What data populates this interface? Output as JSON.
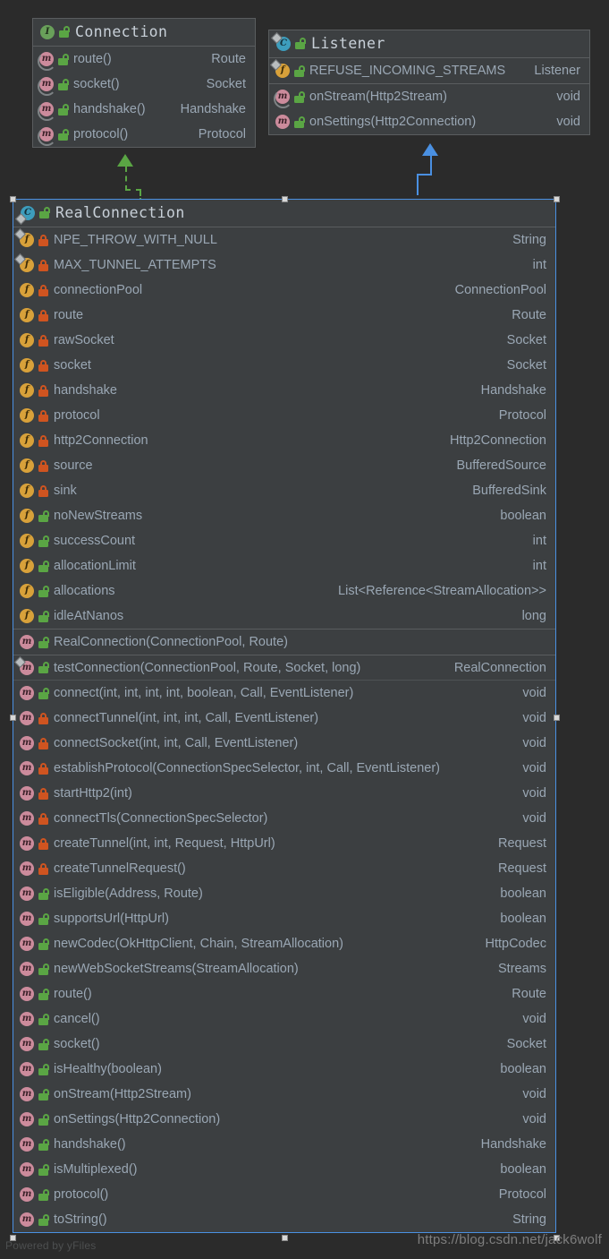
{
  "canvas": {
    "background_color": "#2b2b2b",
    "watermark_tool": "Powered by yFiles",
    "watermark_blog": "https://blog.csdn.net/jack6wolf"
  },
  "boxes": [
    {
      "id": "connection",
      "title": "Connection",
      "stereotype_icon": "interface-icon",
      "visibility": "public",
      "selected": false,
      "sections": [
        {
          "kind": "methods",
          "rows": [
            {
              "icon": "method-icon",
              "abstract": true,
              "static": false,
              "visibility": "public",
              "name": "route()",
              "type": "Route"
            },
            {
              "icon": "method-icon",
              "abstract": true,
              "static": false,
              "visibility": "public",
              "name": "socket()",
              "type": "Socket"
            },
            {
              "icon": "method-icon",
              "abstract": true,
              "static": false,
              "visibility": "public",
              "name": "handshake()",
              "type": "Handshake"
            },
            {
              "icon": "method-icon",
              "abstract": true,
              "static": false,
              "visibility": "public",
              "name": "protocol()",
              "type": "Protocol"
            }
          ]
        }
      ]
    },
    {
      "id": "listener",
      "title": "Listener",
      "stereotype_icon": "class-icon",
      "visibility": "public",
      "selected": false,
      "sections": [
        {
          "kind": "fields",
          "rows": [
            {
              "icon": "field-icon",
              "abstract": false,
              "static": true,
              "visibility": "public",
              "name": "REFUSE_INCOMING_STREAMS",
              "type": "Listener"
            }
          ]
        },
        {
          "kind": "methods",
          "rows": [
            {
              "icon": "method-icon",
              "abstract": true,
              "static": false,
              "visibility": "public",
              "name": "onStream(Http2Stream)",
              "type": "void"
            },
            {
              "icon": "method-icon",
              "abstract": false,
              "static": false,
              "visibility": "public",
              "name": "onSettings(Http2Connection)",
              "type": "void"
            }
          ]
        }
      ]
    },
    {
      "id": "realconnection",
      "title": "RealConnection",
      "stereotype_icon": "class-icon",
      "visibility": "public",
      "selected": true,
      "sections": [
        {
          "kind": "fields",
          "rows": [
            {
              "icon": "field-icon",
              "abstract": false,
              "static": true,
              "visibility": "private",
              "name": "NPE_THROW_WITH_NULL",
              "type": "String"
            },
            {
              "icon": "field-icon",
              "abstract": false,
              "static": true,
              "visibility": "private",
              "name": "MAX_TUNNEL_ATTEMPTS",
              "type": "int"
            },
            {
              "icon": "field-icon",
              "abstract": false,
              "static": false,
              "visibility": "private",
              "name": "connectionPool",
              "type": "ConnectionPool"
            },
            {
              "icon": "field-icon",
              "abstract": false,
              "static": false,
              "visibility": "private",
              "name": "route",
              "type": "Route"
            },
            {
              "icon": "field-icon",
              "abstract": false,
              "static": false,
              "visibility": "private",
              "name": "rawSocket",
              "type": "Socket"
            },
            {
              "icon": "field-icon",
              "abstract": false,
              "static": false,
              "visibility": "private",
              "name": "socket",
              "type": "Socket"
            },
            {
              "icon": "field-icon",
              "abstract": false,
              "static": false,
              "visibility": "private",
              "name": "handshake",
              "type": "Handshake"
            },
            {
              "icon": "field-icon",
              "abstract": false,
              "static": false,
              "visibility": "private",
              "name": "protocol",
              "type": "Protocol"
            },
            {
              "icon": "field-icon",
              "abstract": false,
              "static": false,
              "visibility": "private",
              "name": "http2Connection",
              "type": "Http2Connection"
            },
            {
              "icon": "field-icon",
              "abstract": false,
              "static": false,
              "visibility": "private",
              "name": "source",
              "type": "BufferedSource"
            },
            {
              "icon": "field-icon",
              "abstract": false,
              "static": false,
              "visibility": "private",
              "name": "sink",
              "type": "BufferedSink"
            },
            {
              "icon": "field-icon",
              "abstract": false,
              "static": false,
              "visibility": "public",
              "name": "noNewStreams",
              "type": "boolean"
            },
            {
              "icon": "field-icon",
              "abstract": false,
              "static": false,
              "visibility": "public",
              "name": "successCount",
              "type": "int"
            },
            {
              "icon": "field-icon",
              "abstract": false,
              "static": false,
              "visibility": "public",
              "name": "allocationLimit",
              "type": "int"
            },
            {
              "icon": "field-icon",
              "abstract": false,
              "static": false,
              "visibility": "public",
              "name": "allocations",
              "type": "List<Reference<StreamAllocation>>"
            },
            {
              "icon": "field-icon",
              "abstract": false,
              "static": false,
              "visibility": "public",
              "name": "idleAtNanos",
              "type": "long"
            }
          ]
        },
        {
          "kind": "constructors",
          "rows": [
            {
              "icon": "method-icon",
              "abstract": false,
              "static": false,
              "visibility": "public",
              "name": "RealConnection(ConnectionPool, Route)",
              "type": ""
            }
          ]
        },
        {
          "kind": "methods",
          "rows": [
            {
              "icon": "method-icon",
              "abstract": false,
              "static": true,
              "visibility": "public",
              "name": "testConnection(ConnectionPool, Route, Socket, long)",
              "type": "RealConnection"
            },
            {
              "icon": "method-icon",
              "abstract": false,
              "static": false,
              "visibility": "public",
              "name": "connect(int, int, int, int, boolean, Call, EventListener)",
              "type": "void"
            },
            {
              "icon": "method-icon",
              "abstract": false,
              "static": false,
              "visibility": "private",
              "name": "connectTunnel(int, int, int, Call, EventListener)",
              "type": "void"
            },
            {
              "icon": "method-icon",
              "abstract": false,
              "static": false,
              "visibility": "private",
              "name": "connectSocket(int, int, Call, EventListener)",
              "type": "void"
            },
            {
              "icon": "method-icon",
              "abstract": false,
              "static": false,
              "visibility": "private",
              "name": "establishProtocol(ConnectionSpecSelector, int, Call, EventListener)",
              "type": "void"
            },
            {
              "icon": "method-icon",
              "abstract": false,
              "static": false,
              "visibility": "private",
              "name": "startHttp2(int)",
              "type": "void"
            },
            {
              "icon": "method-icon",
              "abstract": false,
              "static": false,
              "visibility": "private",
              "name": "connectTls(ConnectionSpecSelector)",
              "type": "void"
            },
            {
              "icon": "method-icon",
              "abstract": false,
              "static": false,
              "visibility": "private",
              "name": "createTunnel(int, int, Request, HttpUrl)",
              "type": "Request"
            },
            {
              "icon": "method-icon",
              "abstract": false,
              "static": false,
              "visibility": "private",
              "name": "createTunnelRequest()",
              "type": "Request"
            },
            {
              "icon": "method-icon",
              "abstract": false,
              "static": false,
              "visibility": "public",
              "name": "isEligible(Address, Route)",
              "type": "boolean"
            },
            {
              "icon": "method-icon",
              "abstract": false,
              "static": false,
              "visibility": "public",
              "name": "supportsUrl(HttpUrl)",
              "type": "boolean"
            },
            {
              "icon": "method-icon",
              "abstract": false,
              "static": false,
              "visibility": "public",
              "name": "newCodec(OkHttpClient, Chain, StreamAllocation)",
              "type": "HttpCodec"
            },
            {
              "icon": "method-icon",
              "abstract": false,
              "static": false,
              "visibility": "public",
              "name": "newWebSocketStreams(StreamAllocation)",
              "type": "Streams"
            },
            {
              "icon": "method-icon",
              "abstract": false,
              "static": false,
              "visibility": "public",
              "name": "route()",
              "type": "Route"
            },
            {
              "icon": "method-icon",
              "abstract": false,
              "static": false,
              "visibility": "public",
              "name": "cancel()",
              "type": "void"
            },
            {
              "icon": "method-icon",
              "abstract": false,
              "static": false,
              "visibility": "public",
              "name": "socket()",
              "type": "Socket"
            },
            {
              "icon": "method-icon",
              "abstract": false,
              "static": false,
              "visibility": "public",
              "name": "isHealthy(boolean)",
              "type": "boolean"
            },
            {
              "icon": "method-icon",
              "abstract": false,
              "static": false,
              "visibility": "public",
              "name": "onStream(Http2Stream)",
              "type": "void"
            },
            {
              "icon": "method-icon",
              "abstract": false,
              "static": false,
              "visibility": "public",
              "name": "onSettings(Http2Connection)",
              "type": "void"
            },
            {
              "icon": "method-icon",
              "abstract": false,
              "static": false,
              "visibility": "public",
              "name": "handshake()",
              "type": "Handshake"
            },
            {
              "icon": "method-icon",
              "abstract": false,
              "static": false,
              "visibility": "public",
              "name": "isMultiplexed()",
              "type": "boolean"
            },
            {
              "icon": "method-icon",
              "abstract": false,
              "static": false,
              "visibility": "public",
              "name": "protocol()",
              "type": "Protocol"
            },
            {
              "icon": "method-icon",
              "abstract": false,
              "static": false,
              "visibility": "public",
              "name": "toString()",
              "type": "String"
            }
          ]
        }
      ]
    }
  ],
  "connectors": [
    {
      "id": "realization-connection",
      "style": "dashed",
      "color": "#5aa544",
      "arrow": "triangle-up",
      "from": "realconnection",
      "to": "connection"
    },
    {
      "id": "generalization-listener",
      "style": "solid",
      "color": "#4a90e2",
      "arrow": "triangle-up",
      "from": "realconnection",
      "to": "listener"
    }
  ]
}
